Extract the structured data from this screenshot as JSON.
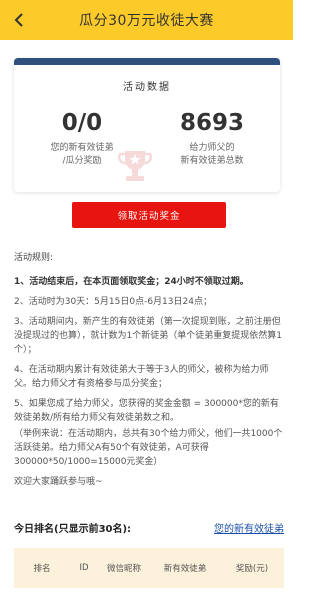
{
  "header": {
    "title": "瓜分30万元收徒大赛"
  },
  "stats": {
    "heading": "活动数据",
    "left_value": "0/0",
    "left_caption_1": "您的新有效徒弟",
    "left_caption_2": "/瓜分奖励",
    "right_value": "8693",
    "right_caption_1": "给力师父的",
    "right_caption_2": "新有效徒弟总数"
  },
  "claim_button": "领取活动奖金",
  "rules": {
    "title": "活动规则:",
    "items": [
      "1、活动结束后，在本页面领取奖金；24小时不领取过期。",
      "2、活动时为30天：5月15日0点-6月13日24点；",
      "3、活动期间内，新产生的有效徒弟（第一次提现到账，之前注册但没提现过的也算），就计数为1个新徒弟（单个徒弟重复提现依然算1个）；",
      "4、在活动期内累计有效徒弟大于等于3人的师父，被称为给力师父。给力师父才有资格参与瓜分奖金；",
      "5、如果您成了给力师父，您获得的奖金金额 = 300000*您的新有效徒弟数/所有给力师父有效徒弟数之和。",
      "（举例来说：在活动期内，总共有30个给力师父，他们一共1000个活跃徒弟。给力师父A有50个有效徒弟，A可获得300000*50/1000=15000元奖金）",
      "欢迎大家踊跃参与哦~"
    ]
  },
  "ranking": {
    "title": "今日排名(只显示前30名):",
    "link": "您的新有效徒弟",
    "columns": [
      "排名",
      "ID",
      "微信昵称",
      "新有效徒弟",
      "奖励(元)"
    ]
  },
  "colors": {
    "header": "#FCCB2A",
    "button": "#E8140F",
    "card_bar": "#2F4F7E",
    "table_head": "#FCF1DB",
    "link": "#1C4FA8"
  }
}
